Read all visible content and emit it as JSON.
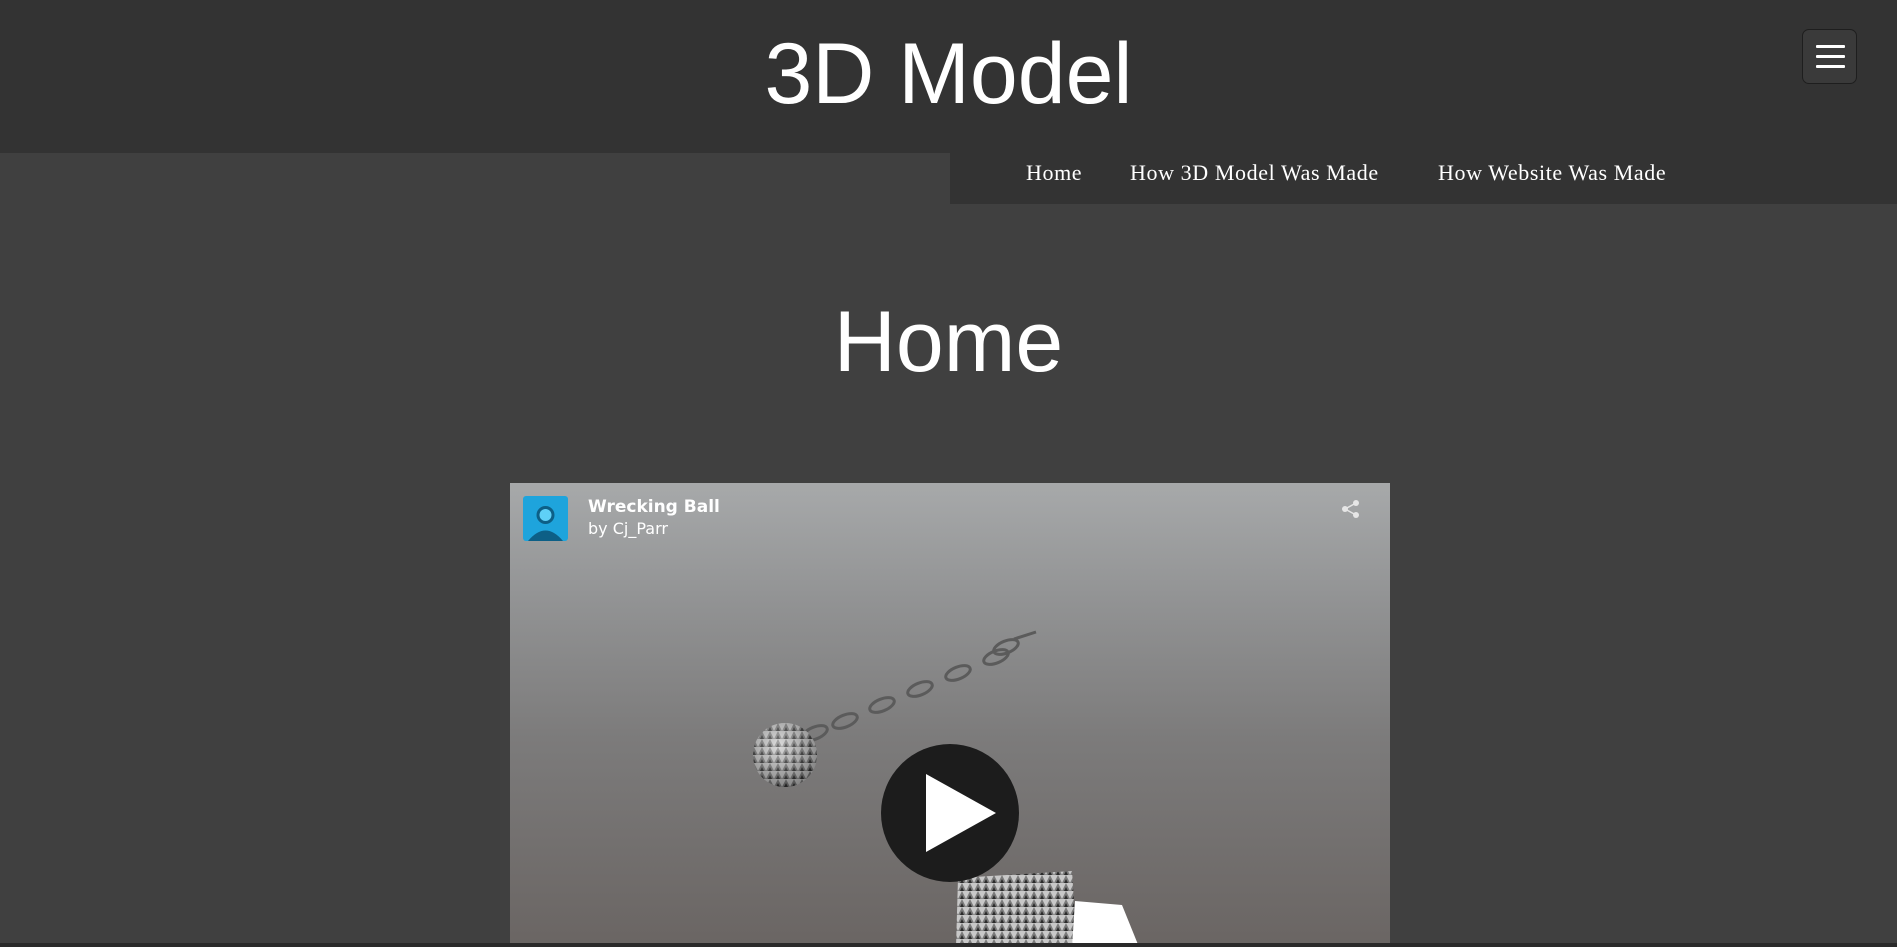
{
  "header": {
    "title": "3D Model",
    "menu_icon": "hamburger-menu-icon"
  },
  "nav": {
    "links": [
      {
        "label": "Home"
      },
      {
        "label": "How 3D Model Was Made"
      },
      {
        "label": "How Website Was Made"
      }
    ]
  },
  "main": {
    "heading": "Home"
  },
  "viewer": {
    "model_title": "Wrecking Ball",
    "author": "by Cj_Parr",
    "avatar_icon": "user-avatar-icon",
    "share_icon": "share-icon",
    "play_icon": "play-icon"
  },
  "colors": {
    "header_bg": "#333333",
    "page_bg": "#404040",
    "avatar_bg": "#1ea4dc",
    "play_button_bg": "#1c1c1c"
  }
}
